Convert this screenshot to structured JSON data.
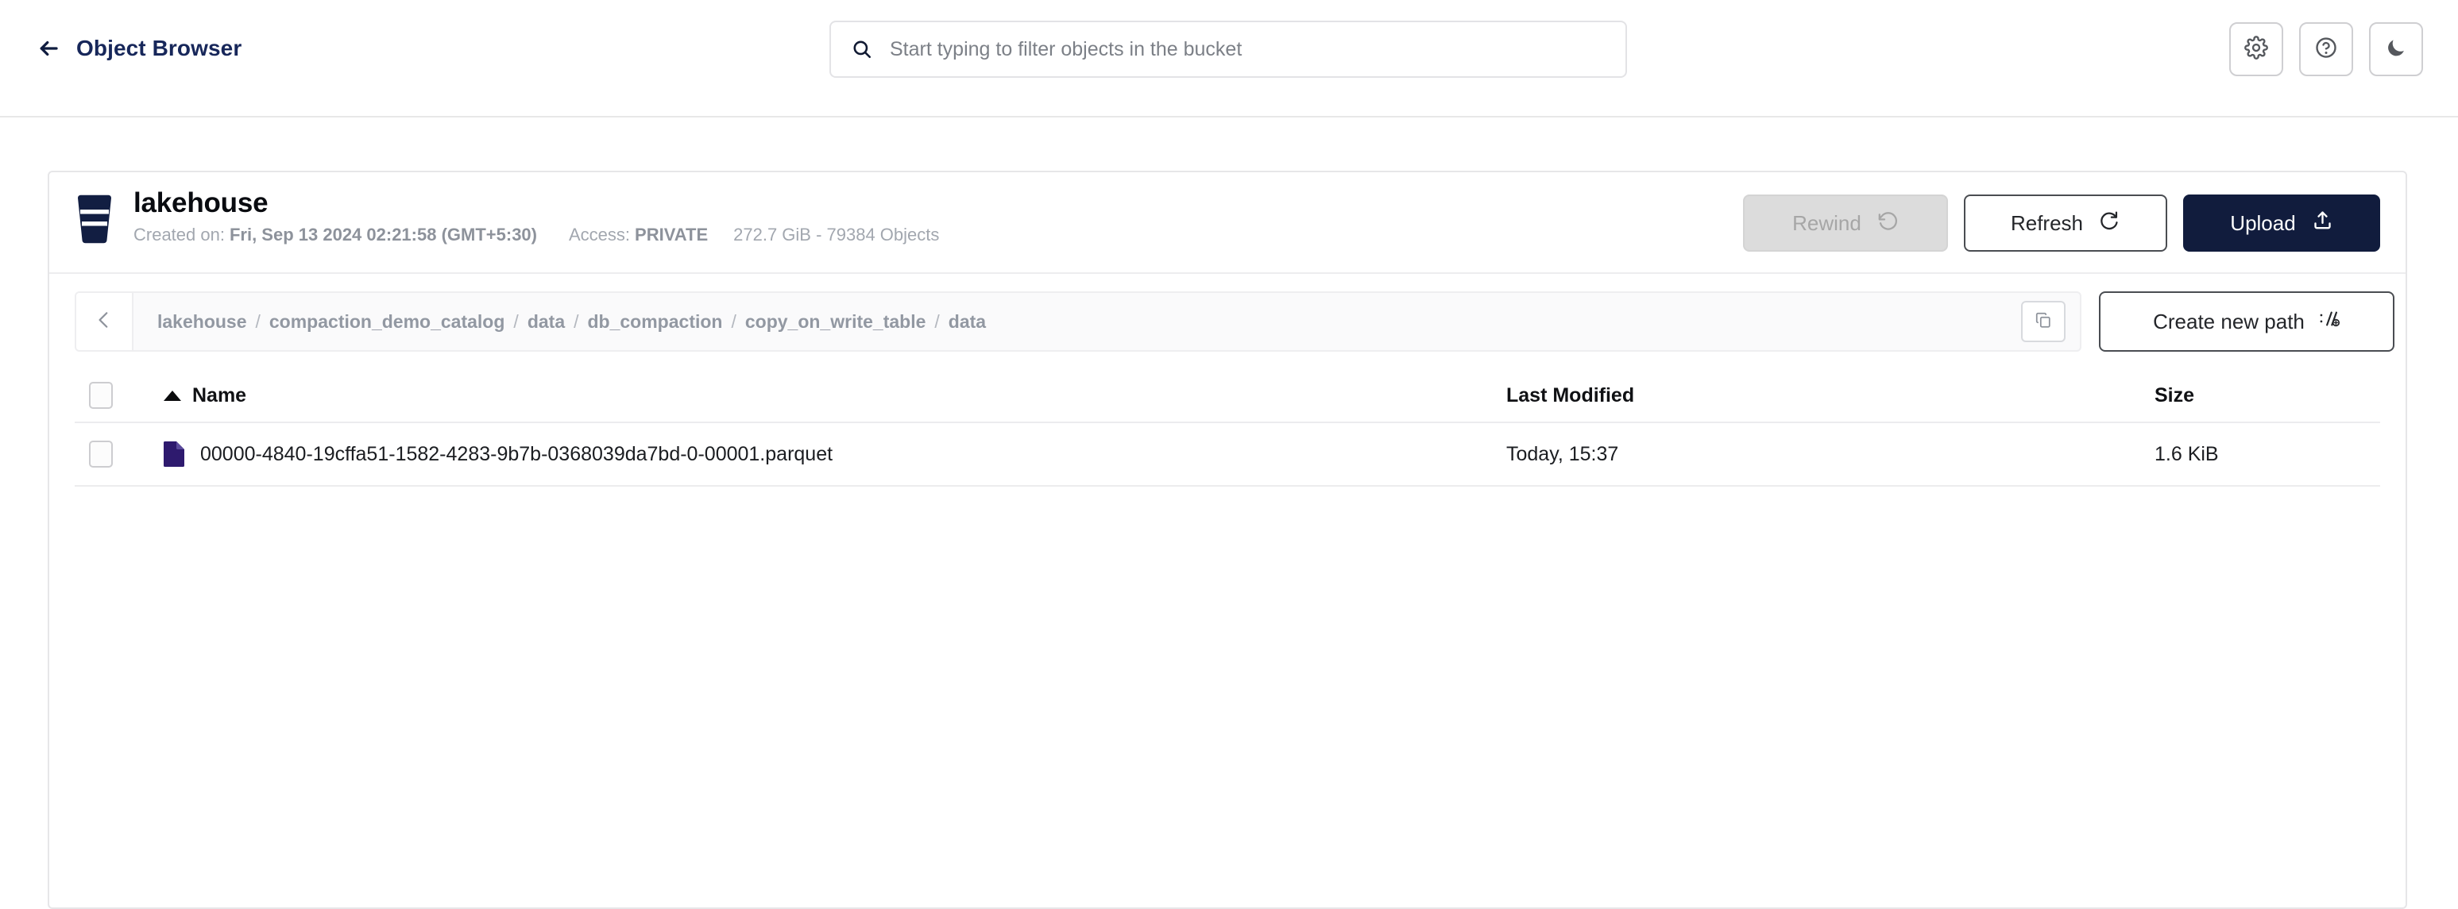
{
  "topbar": {
    "back_label": "Object Browser",
    "back_icon": "arrow-left-icon",
    "search": {
      "placeholder": "Start typing to filter objects in the bucket",
      "value": "",
      "icon": "search-icon"
    },
    "actions": [
      {
        "icon": "gear-icon",
        "name": "settings-button"
      },
      {
        "icon": "help-circle-icon",
        "name": "help-button"
      },
      {
        "icon": "moon-icon",
        "name": "dark-mode-button"
      }
    ]
  },
  "bucket": {
    "icon": "bucket-icon",
    "name": "lakehouse",
    "created_label": "Created on:",
    "created_value": "Fri, Sep 13 2024 02:21:58 (GMT+5:30)",
    "access_label": "Access:",
    "access_value": "PRIVATE",
    "usage": "272.7 GiB - 79384 Objects",
    "actions": {
      "rewind_label": "Rewind",
      "rewind_icon": "rewind-clock-icon",
      "rewind_disabled": true,
      "refresh_label": "Refresh",
      "refresh_icon": "refresh-icon",
      "upload_label": "Upload",
      "upload_icon": "upload-icon"
    }
  },
  "path": {
    "back_icon": "chevron-left-icon",
    "copy_icon": "copy-icon",
    "crumbs": [
      "lakehouse",
      "compaction_demo_catalog",
      "data",
      "db_compaction",
      "copy_on_write_table",
      "data"
    ],
    "separator": "/",
    "create_label": "Create new path",
    "create_icon": "new-path-icon"
  },
  "table": {
    "select_all_checkbox": false,
    "columns": {
      "name": "Name",
      "last_modified": "Last Modified",
      "size": "Size"
    },
    "sort": {
      "column": "Name",
      "direction": "asc",
      "icon": "sort-asc-caret-icon"
    },
    "rows": [
      {
        "checked": false,
        "icon": "parquet-file-icon",
        "name": "00000-4840-19cffa51-1582-4283-9b7b-0368039da7bd-0-00001.parquet",
        "last_modified": "Today, 15:37",
        "size": "1.6 KiB"
      }
    ]
  },
  "colors": {
    "brand_navy": "#111c3d",
    "file_icon_purple": "#2e1a6e",
    "muted_text": "#9a9fa8",
    "border": "#e6e6e8"
  }
}
